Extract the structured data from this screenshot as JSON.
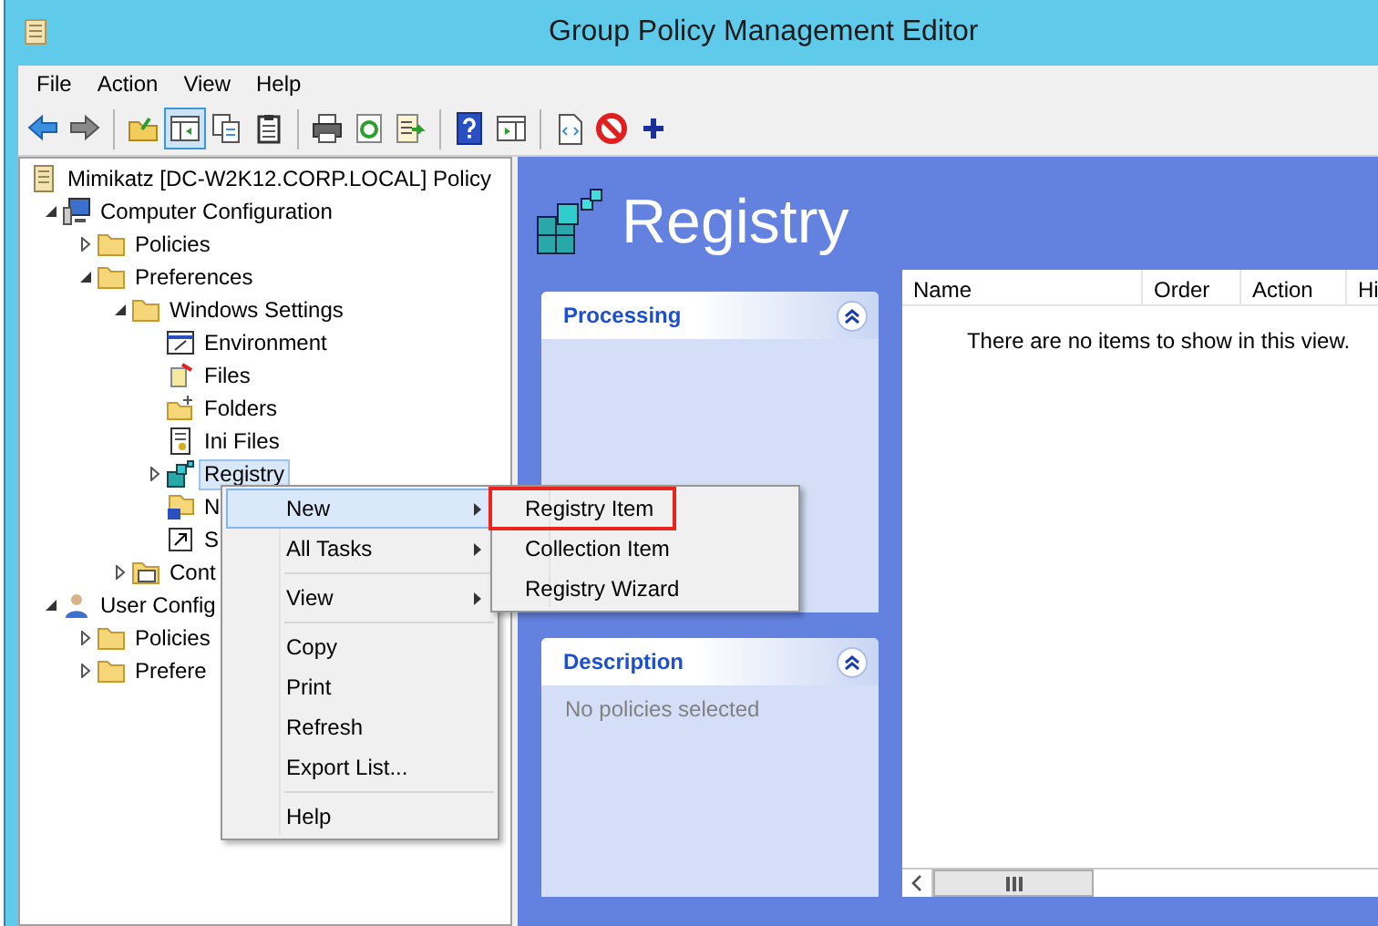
{
  "window": {
    "title": "Group Policy Management Editor"
  },
  "menu_bar": [
    {
      "label": "File"
    },
    {
      "label": "Action"
    },
    {
      "label": "View"
    },
    {
      "label": "Help"
    }
  ],
  "toolbar": [
    {
      "kind": "back",
      "pressed": false
    },
    {
      "kind": "forward",
      "pressed": false
    },
    {
      "kind": "separator"
    },
    {
      "kind": "up",
      "pressed": false
    },
    {
      "kind": "console-tree",
      "pressed": true
    },
    {
      "kind": "copy",
      "pressed": false
    },
    {
      "kind": "paste",
      "pressed": false
    },
    {
      "kind": "separator"
    },
    {
      "kind": "print",
      "pressed": false
    },
    {
      "kind": "refresh",
      "pressed": false
    },
    {
      "kind": "export",
      "pressed": false
    },
    {
      "kind": "separator"
    },
    {
      "kind": "help",
      "pressed": false
    },
    {
      "kind": "action-pane",
      "pressed": false
    },
    {
      "kind": "separator"
    },
    {
      "kind": "script",
      "pressed": false
    },
    {
      "kind": "stop",
      "pressed": false
    },
    {
      "kind": "add",
      "pressed": false
    }
  ],
  "tree": [
    {
      "label": "Mimikatz [DC-W2K12.CORP.LOCAL] Policy",
      "kind": "policy",
      "selected": false,
      "children": [
        {
          "label": "Computer Configuration",
          "kind": "computer",
          "expanded": true,
          "selected": false,
          "children": [
            {
              "label": "Policies",
              "kind": "folder",
              "expanded": false,
              "selected": false
            },
            {
              "label": "Preferences",
              "kind": "folder",
              "expanded": true,
              "selected": false,
              "children": [
                {
                  "label": "Windows Settings",
                  "kind": "folder",
                  "expanded": true,
                  "selected": false,
                  "children": [
                    {
                      "label": "Environment",
                      "kind": "environment",
                      "selected": false
                    },
                    {
                      "label": "Files",
                      "kind": "files",
                      "selected": false
                    },
                    {
                      "label": "Folders",
                      "kind": "folders",
                      "selected": false
                    },
                    {
                      "label": "Ini Files",
                      "kind": "ini",
                      "selected": false
                    },
                    {
                      "label": "Registry",
                      "kind": "registry",
                      "expanded": false,
                      "selected": true
                    },
                    {
                      "label": "N",
                      "kind": "network",
                      "selected": false
                    },
                    {
                      "label": "S",
                      "kind": "shortcut",
                      "selected": false
                    }
                  ]
                },
                {
                  "label": "Cont",
                  "kind": "control-panel",
                  "expanded": false,
                  "selected": false
                }
              ]
            }
          ]
        },
        {
          "label": "User Config",
          "kind": "user",
          "expanded": true,
          "selected": false,
          "children": [
            {
              "label": "Policies",
              "kind": "folder",
              "expanded": false,
              "selected": false
            },
            {
              "label": "Prefere",
              "kind": "folder",
              "expanded": false,
              "selected": false
            }
          ]
        }
      ]
    }
  ],
  "context_menu": [
    {
      "kind": "item",
      "label": "New",
      "submenu": true,
      "selected": true
    },
    {
      "kind": "item",
      "label": "All Tasks",
      "submenu": true,
      "selected": false
    },
    {
      "kind": "separator"
    },
    {
      "kind": "item",
      "label": "View",
      "submenu": true,
      "selected": false
    },
    {
      "kind": "separator"
    },
    {
      "kind": "item",
      "label": "Copy",
      "submenu": false,
      "selected": false
    },
    {
      "kind": "item",
      "label": "Print",
      "submenu": false,
      "selected": false
    },
    {
      "kind": "item",
      "label": "Refresh",
      "submenu": false,
      "selected": false
    },
    {
      "kind": "item",
      "label": "Export List...",
      "submenu": false,
      "selected": false
    },
    {
      "kind": "separator"
    },
    {
      "kind": "item",
      "label": "Help",
      "submenu": false,
      "selected": false
    }
  ],
  "submenu": [
    {
      "label": "Registry Item",
      "outlined": true
    },
    {
      "label": "Collection Item",
      "outlined": false
    },
    {
      "label": "Registry Wizard",
      "outlined": false
    }
  ],
  "details": {
    "title": "Registry",
    "panels": [
      {
        "title": "Processing",
        "expanded": true
      },
      {
        "title": "Description",
        "expanded": true,
        "text": "No policies selected"
      }
    ],
    "list": {
      "columns": [
        "Name",
        "Order",
        "Action",
        "Hi"
      ],
      "empty_message": "There are no items to show in this view."
    }
  }
}
